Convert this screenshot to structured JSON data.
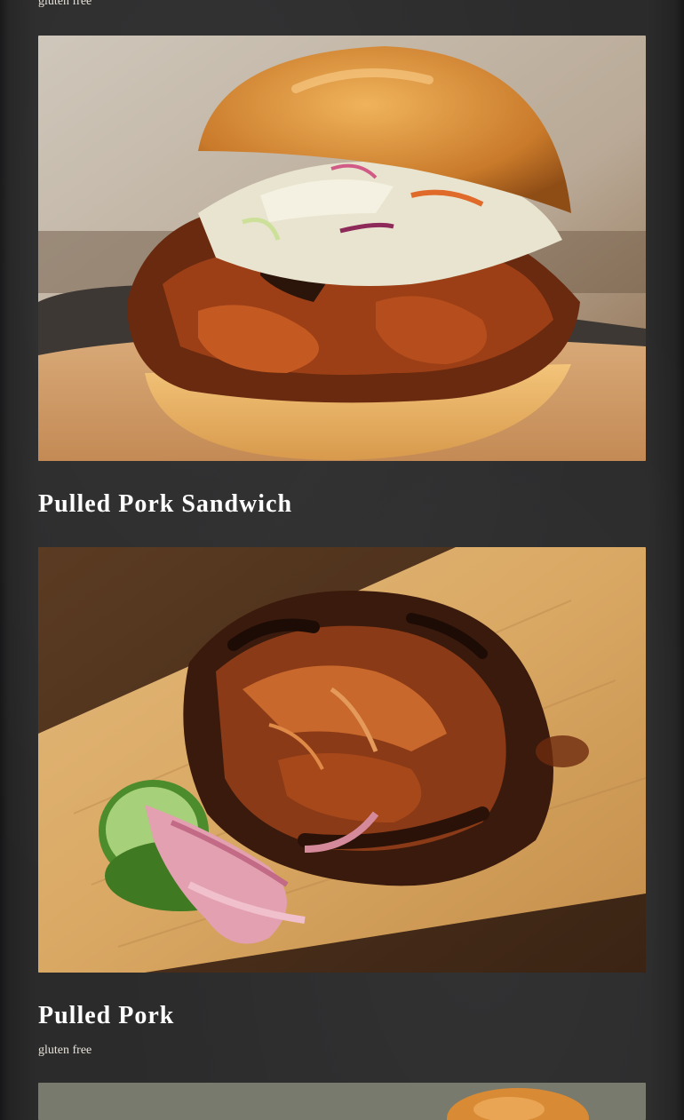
{
  "menu": {
    "previous_note": "gluten free",
    "items": [
      {
        "name": "Pulled Pork Sandwich",
        "note": ""
      },
      {
        "name": "Pulled Pork",
        "note": "gluten free"
      }
    ]
  },
  "colors": {
    "background": "#2a2a2b",
    "title": "#ffffff",
    "note": "#e6e2da"
  }
}
